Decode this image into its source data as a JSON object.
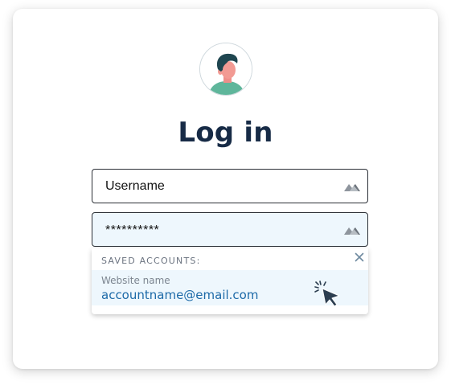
{
  "page": {
    "title": "Log in"
  },
  "fields": {
    "username_value": "Username",
    "password_value": "**********"
  },
  "icons": {
    "avatar": "user-avatar-illustration",
    "field_icon": "password-manager-key-icon",
    "close": "close-icon",
    "cursor": "pointer-cursor-click-icon"
  },
  "saved_accounts": {
    "header": "SAVED ACCOUNTS:",
    "items": [
      {
        "site": "Website name",
        "email": "accountname@email.com"
      }
    ]
  },
  "colors": {
    "title": "#172b46",
    "field_border": "#2b2f36",
    "highlight_bg": "#eef7fd",
    "email_link": "#1d6aa8",
    "muted_text": "#7c8590",
    "icon_gray": "#8e959d"
  }
}
